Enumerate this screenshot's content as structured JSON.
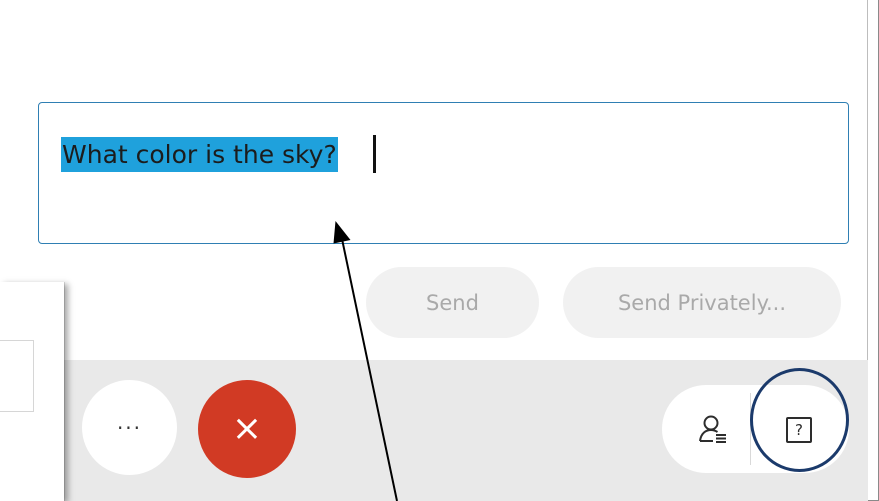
{
  "question": {
    "text": "What color is the sky?"
  },
  "actions": {
    "send_label": "Send",
    "send_privately_label": "Send Privately..."
  },
  "toolbar": {
    "more_label": "···",
    "close_label": "×",
    "help_label": "?"
  },
  "icons": {
    "more": "more-horizontal-icon",
    "close": "close-icon",
    "participants": "participants-icon",
    "help": "help-icon"
  },
  "colors": {
    "selection": "#1fa1dc",
    "input_border": "#2f7fb3",
    "close_button": "#d13a24",
    "highlight_circle": "#1b3a6b",
    "disabled_text": "#a9a9a9"
  }
}
